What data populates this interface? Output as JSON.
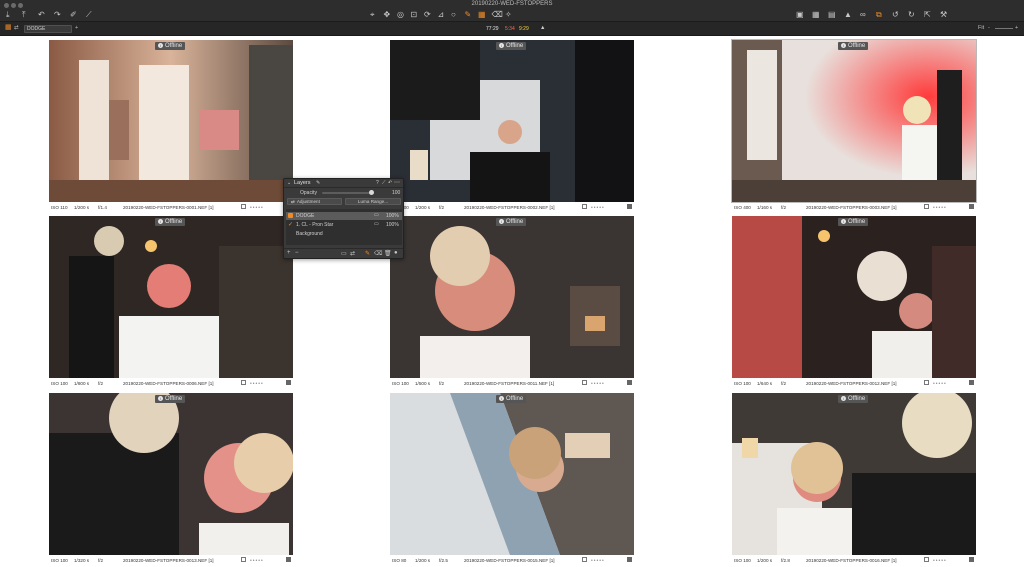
{
  "window": {
    "title": "20190220-WED-FSTOPPERS"
  },
  "toolbar": {
    "left_icons": [
      "import-icon",
      "export-icon",
      "undo-icon",
      "redo-icon",
      "brush-icon",
      "eyedropper-icon"
    ],
    "center_icons": [
      "pointer-tool-icon",
      "pan-tool-icon",
      "loupe-tool-icon",
      "crop-tool-icon",
      "rotate-tool-icon",
      "keystone-tool-icon",
      "spot-tool-icon",
      "brush-mask-icon",
      "gradient-mask-icon",
      "erase-mask-icon",
      "white-balance-picker-icon"
    ],
    "right_icons": [
      "viewer-icon",
      "grid-icon",
      "compare-icon",
      "warning-icon",
      "glasses-icon",
      "copy-adjustments-icon",
      "reset-icon",
      "rotate-icon",
      "apply-icon",
      "tools-icon"
    ],
    "center_glyphs": [
      "⌖",
      "✥",
      "◎",
      "⊡",
      "⟳",
      "⊿",
      "○",
      "✎",
      "▦",
      "⌫",
      "✧"
    ],
    "left_glyphs": [
      "⤓",
      "⤒",
      "↶",
      "↷",
      "✐",
      "⟋"
    ],
    "right_glyphs": [
      "▣",
      "▦",
      "▤",
      "▲",
      "∞",
      "⧉",
      "↺",
      "↻",
      "⇱",
      "⚒"
    ]
  },
  "subbar": {
    "layer_name": "DODGE",
    "readouts": [
      {
        "label": "77:29",
        "color": "#e8e8e8"
      },
      {
        "label": "5:34",
        "color": "#ff6a5a"
      },
      {
        "label": "9:29",
        "color": "#ffd43a"
      }
    ],
    "fit_label": "Fit"
  },
  "accent": "#f08a24",
  "offline_label": "Offline",
  "images": [
    {
      "iso": "ISO 110",
      "shutter": "1/200 s",
      "aperture": "f/1.4",
      "file": "20190220-WED-FSTOPPERS-0001.NEF [1]"
    },
    {
      "iso": "ISO 100",
      "shutter": "1/200 s",
      "aperture": "f/2",
      "file": "20190220-WED-FSTOPPERS-0002.NEF [1]"
    },
    {
      "iso": "ISO 400",
      "shutter": "1/160 s",
      "aperture": "f/2",
      "file": "20190220-WED-FSTOPPERS-0003.NEF [1]"
    },
    {
      "iso": "ISO 100",
      "shutter": "1/800 s",
      "aperture": "f/2",
      "file": "20190220-WED-FSTOPPERS-0006.NEF [1]"
    },
    {
      "iso": "ISO 100",
      "shutter": "1/500 s",
      "aperture": "f/2",
      "file": "20190220-WED-FSTOPPERS-0011.NEF [1]"
    },
    {
      "iso": "ISO 100",
      "shutter": "1/640 s",
      "aperture": "f/2",
      "file": "20190220-WED-FSTOPPERS-0012.NEF [1]"
    },
    {
      "iso": "ISO 100",
      "shutter": "1/320 s",
      "aperture": "f/2",
      "file": "20190220-WED-FSTOPPERS-0013.NEF [1]"
    },
    {
      "iso": "ISO 80",
      "shutter": "1/200 s",
      "aperture": "f/2.5",
      "file": "20190220-WED-FSTOPPERS-0015.NEF [1]"
    },
    {
      "iso": "ISO 100",
      "shutter": "1/200 s",
      "aperture": "f/2.8",
      "file": "20190220-WED-FSTOPPERS-0016.NEF [1]"
    }
  ],
  "layers_panel": {
    "title": "Layers",
    "opacity_label": "Opacity",
    "opacity_value": "100",
    "opacity_fraction": 1.0,
    "adjustment_label": "Adjustment",
    "luma_label": "Luma Range...",
    "layers": [
      {
        "name": "DODGE",
        "value": "100%",
        "selected": true
      },
      {
        "name": "1. CL - Pron Star",
        "value": "100%",
        "selected": false
      },
      {
        "name": "Background",
        "value": "",
        "selected": false
      }
    ]
  }
}
